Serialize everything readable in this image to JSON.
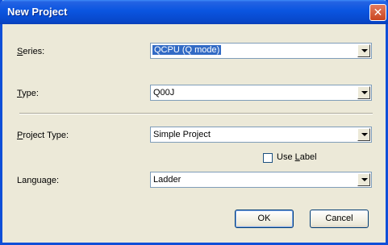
{
  "window": {
    "title": "New Project",
    "close_glyph": "✕"
  },
  "fields": {
    "series": {
      "label_prefix": "",
      "label_hotkey": "S",
      "label_rest": "eries:",
      "value": "QCPU (Q mode)"
    },
    "type": {
      "label_prefix": "",
      "label_hotkey": "T",
      "label_rest": "ype:",
      "value": "Q00J"
    },
    "project_type": {
      "label_prefix": "",
      "label_hotkey": "P",
      "label_rest": "roject Type:",
      "value": "Simple Project"
    },
    "language": {
      "label_prefix": "Langua",
      "label_hotkey": "g",
      "label_rest": "e:",
      "value": "Ladder"
    }
  },
  "use_label": {
    "prefix": "Use ",
    "hotkey": "L",
    "rest": "abel",
    "checked": false
  },
  "buttons": {
    "ok": "OK",
    "cancel": "Cancel"
  },
  "colors": {
    "title_bar": "#0a55e0",
    "selection": "#316ac5",
    "dialog_bg": "#ece9d8"
  }
}
